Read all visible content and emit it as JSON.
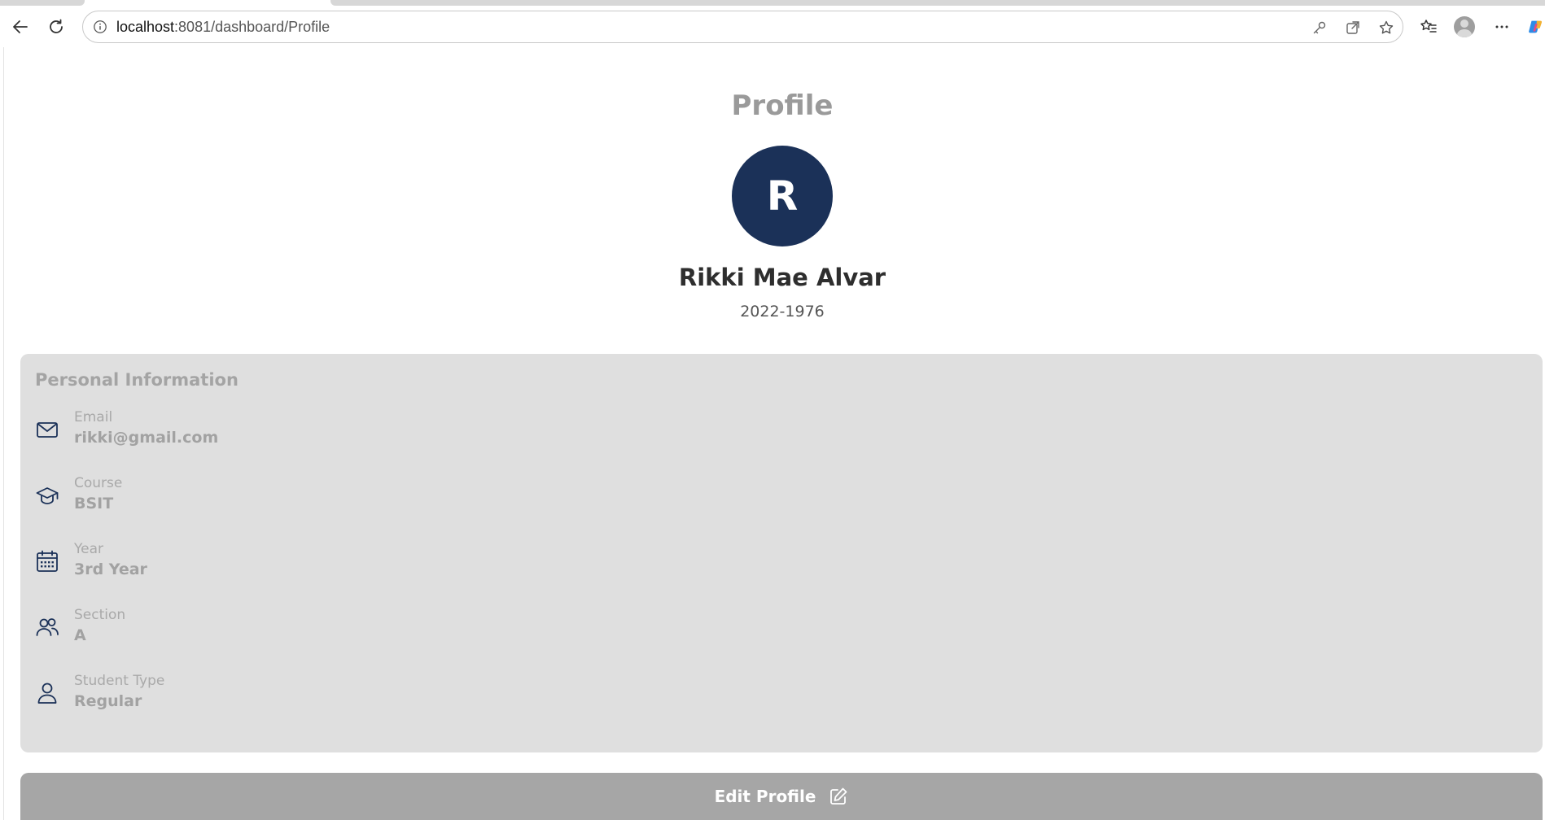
{
  "browser": {
    "url_host": "localhost",
    "url_rest": ":8081/dashboard/Profile"
  },
  "page": {
    "title": "Profile",
    "avatar_initial": "R",
    "avatar_color": "#1b3158",
    "user_name": "Rikki Mae Alvar",
    "student_id": "2022-1976"
  },
  "personal_info": {
    "title": "Personal Information",
    "fields": [
      {
        "icon": "mail-icon",
        "label": "Email",
        "value": "rikki@gmail.com"
      },
      {
        "icon": "graduation-cap-icon",
        "label": "Course",
        "value": "BSIT"
      },
      {
        "icon": "calendar-icon",
        "label": "Year",
        "value": "3rd Year"
      },
      {
        "icon": "users-icon",
        "label": "Section",
        "value": "A"
      },
      {
        "icon": "user-icon",
        "label": "Student Type",
        "value": "Regular"
      }
    ]
  },
  "actions": {
    "edit_label": "Edit Profile"
  },
  "colors": {
    "accent": "#1b3158",
    "card_bg": "#dfdfdf",
    "button_bg": "#a6a6a6"
  }
}
